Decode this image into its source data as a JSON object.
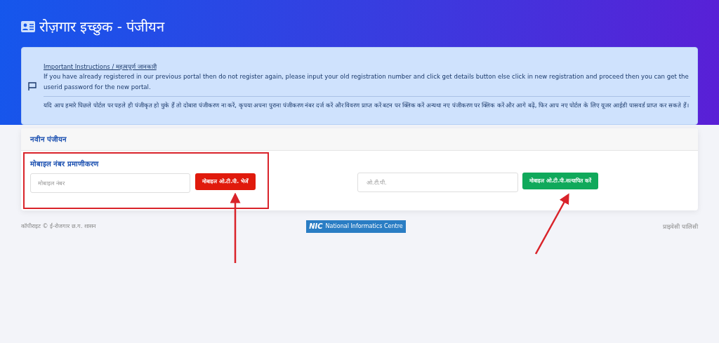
{
  "page_title": "रोज़गार इच्छुक - पंजीयन",
  "notice": {
    "heading": "Important Instructions / महत्वपूर्ण जानकारी",
    "english": "If you have already registered in our previous portal then do not register again, please input your old registration number and click get details button else click in new registration and proceed then you can get the userid password for the new portal.",
    "hindi": "यदि आप हमारे पिछले पोर्टल पर पहले ही पंजीकृत हो चुके हैं तो दोबारा पंजीकरण ना करें, कृपया अपना पुराना पंजीकरण नंबर दर्ज करें और विवरण प्राप्त करें बटन पर क्लिक करें अन्यथा नए पंजीकरण पर क्लिक करें और आगे बढ़ें, फिर आप नए पोर्टल के लिए यूजर आईडी पासवर्ड प्राप्त कर सकते हैं।"
  },
  "card": {
    "header": "नवीन पंजीयन",
    "section_title": "मोबाइल नंबर प्रमाणीकरण",
    "mobile_field": {
      "placeholder": "मोबाइल नंबर"
    },
    "send_button": "मोबाइल ओ.टी.पी. भेजें",
    "otp_field": {
      "placeholder": "ओ.टी.पी."
    },
    "verify_button": "मोबाइल ओ.टी.पी.सत्यापित करें"
  },
  "footer": {
    "copyright": "कॉपीराइट © ई-रोजगार छ.ग. शासन",
    "logo": {
      "mark": "NIC",
      "caption": "National Informatics Centre"
    },
    "privacy_link": "प्राइवेसी पालिसी"
  }
}
